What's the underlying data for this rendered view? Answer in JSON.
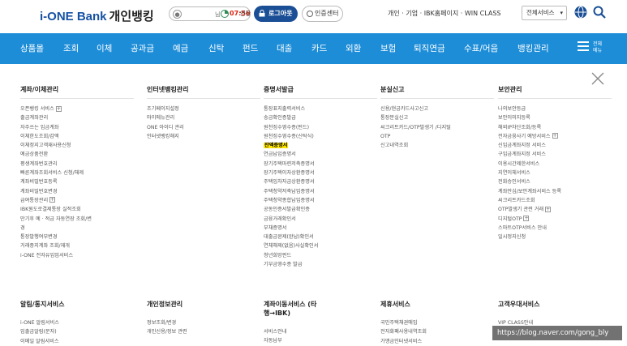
{
  "header": {
    "logo_brand": "i-ONE Bank",
    "logo_service": "개인뱅킹",
    "session_honorific": "님",
    "session_timer": "07:56",
    "session_extend": "연장",
    "logout_label": "로그아웃",
    "cert_label": "인증센터",
    "top_links": "개인 · 기업 · IBK홈페이지 · WIN CLASS",
    "all_services": "전체서비스"
  },
  "nav": {
    "items": [
      "상품몰",
      "조회",
      "이체",
      "공과금",
      "예금",
      "신탁",
      "펀드",
      "대출",
      "카드",
      "외환",
      "보험",
      "퇴직연금",
      "수표/어음",
      "뱅킹관리"
    ],
    "menu_label": "전체메뉴"
  },
  "columns": [
    {
      "title": "계좌/이체관리",
      "items": [
        {
          "text": "오픈뱅킹 서비스",
          "plus": true
        },
        {
          "text": "출금계좌관리"
        },
        {
          "text": "자주쓰는 입금계좌"
        },
        {
          "text": "이체한도조회/감액"
        },
        {
          "text": "이체정지고객재사용신청"
        },
        {
          "text": "예금상품전환"
        },
        {
          "text": "평생계좌번호관리"
        },
        {
          "text": "빠른계좌조회서비스 신청/해제",
          "two": true
        },
        {
          "text": "계좌비밀번호등록"
        },
        {
          "text": "계좌비밀번호변경"
        },
        {
          "text": "급여통장관리",
          "plus": true
        },
        {
          "text": "IBK원도로결제통장 실적조회",
          "two": true
        },
        {
          "text": "만기후 예 · 적금 자동연장 조회/변경",
          "two": true
        },
        {
          "text": "통장발행여부변경"
        },
        {
          "text": "거래중지계좌 조회/재개"
        },
        {
          "text": "i-ONE 전자유입업서비스"
        }
      ]
    },
    {
      "title": "인터넷뱅킹관리",
      "items": [
        {
          "text": "조기페이지설정"
        },
        {
          "text": "마이메뉴관리"
        },
        {
          "text": "ONE 아이디 관리"
        },
        {
          "text": "인터넷뱅킹해지"
        }
      ]
    },
    {
      "title": "증명서발급",
      "items": [
        {
          "text": "통장표지출력서비스"
        },
        {
          "text": "송금확인증발급"
        },
        {
          "text": "원천징수영수증(펀드)"
        },
        {
          "text": "원천징수영수증(신탁식)"
        },
        {
          "text": "잔액증명서",
          "highlight": true
        },
        {
          "text": "연금납입증명서"
        },
        {
          "text": "장기주택마련저축증명서"
        },
        {
          "text": "장기주택이자상환증명서"
        },
        {
          "text": "주택임차자금상환증명서"
        },
        {
          "text": "주택청약저축납입증명서"
        },
        {
          "text": "주택청약종합납입증명서"
        },
        {
          "text": "공동인증서발급확인증"
        },
        {
          "text": "금융거래확인서"
        },
        {
          "text": "부채증명서"
        },
        {
          "text": "대출금완제(완납)확인서"
        },
        {
          "text": "연체해제(없음)사실확인서"
        },
        {
          "text": "청년희망펀드"
        },
        {
          "text": "기부금영수증 발급"
        }
      ]
    },
    {
      "title": "분실신고",
      "items": [
        {
          "text": "신용/현금카드사고신고"
        },
        {
          "text": "통장분실신고"
        },
        {
          "text": "씨크리트카드/OTP발생기 /디지털OTP",
          "two": true
        },
        {
          "text": "신고내역조회"
        }
      ]
    },
    {
      "title": "보안관리",
      "items": [
        {
          "text": "나의보안등급"
        },
        {
          "text": "보안이미지등록"
        },
        {
          "text": "해외IP차단조회/등록"
        },
        {
          "text": "전자금융사기 예방서비스",
          "plus": true
        },
        {
          "text": "신입금계좌지정 서비스"
        },
        {
          "text": "구입금계좌지정 서비스"
        },
        {
          "text": "이용시간제한서비스"
        },
        {
          "text": "지연이체서비스"
        },
        {
          "text": "전화승인서비스"
        },
        {
          "text": "계좌안심/보안계좌서비스 등록"
        },
        {
          "text": "씨크리트카드조회"
        },
        {
          "text": "OTP발생기 관련 거래",
          "plus": true
        },
        {
          "text": "디지털OTP",
          "plus": true
        },
        {
          "text": "스마트OTP서비스 안내"
        },
        {
          "text": "일시정지신청"
        }
      ]
    }
  ],
  "bottom_columns": [
    {
      "title": "알림/통지서비스",
      "items": [
        "i-ONE 알림서비스",
        "입출금알림(문자)",
        "이메일 알림서비스"
      ]
    },
    {
      "title": "개인정보관리",
      "items": [
        "정보조회/변경",
        "개인신용/정보 관련"
      ]
    },
    {
      "title": "계좌이동서비스 (타행→IBK)",
      "items": [
        "서비스안내",
        "자동납부"
      ]
    },
    {
      "title": "제휴서비스",
      "items": [
        "국민주택채권매입",
        "전자화폐사용내역조회",
        "가맹금인터넷서비스"
      ]
    },
    {
      "title": "고객우대서비스",
      "items": [
        "VIP CLASS안내"
      ]
    }
  ],
  "watermark": "https://blog.naver.com/gong_bly"
}
